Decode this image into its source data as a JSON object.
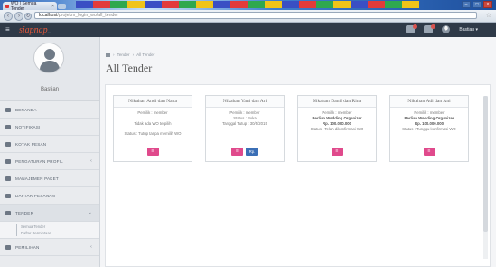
{
  "browser": {
    "tab_title": "WO | Semua Tender",
    "tab_close": "×",
    "url_host": "localhost",
    "url_path": "/projekm_login_wo/all_tender",
    "window_buttons": [
      "–",
      "□",
      "×"
    ],
    "strip_colors": [
      "#3a4fc4",
      "#e23b3b",
      "#2fa84f",
      "#f0c419",
      "#3a4fc4",
      "#e23b3b",
      "#2fa84f",
      "#f0c419",
      "#3a4fc4",
      "#e23b3b",
      "#2fa84f",
      "#f0c419",
      "#3a4fc4",
      "#e23b3b",
      "#2fa84f",
      "#f0c419",
      "#3a4fc4",
      "#e23b3b",
      "#2fa84f",
      "#f0c419"
    ]
  },
  "app": {
    "logo": "siapnap",
    "logo_suffix": "...",
    "menu_icon": "≡",
    "user_name": "Bastian ▾"
  },
  "sidebar": {
    "profile_name": "Bastian",
    "items": [
      {
        "label": "BERANDA",
        "icon": "home-icon"
      },
      {
        "label": "NOTIFIKASI",
        "icon": "bell-icon"
      },
      {
        "label": "KOTAK PESAN",
        "icon": "envelope-icon"
      },
      {
        "label": "PENGATURAN PROFIL",
        "icon": "gear-icon",
        "caret": "‹"
      },
      {
        "label": "MANAJEMEN PAKET",
        "icon": "briefcase-icon"
      },
      {
        "label": "DAFTAR PESANAN",
        "icon": "cart-icon"
      },
      {
        "label": "TENDER",
        "icon": "gavel-icon",
        "caret": "⌄"
      },
      {
        "label": "PEMILIHAN",
        "icon": "star-icon",
        "caret": "‹"
      }
    ],
    "submenu": [
      "Semua Tender",
      "Daftar Permintaan"
    ]
  },
  "main": {
    "breadcrumb": [
      "Tender",
      "All Tender"
    ],
    "breadcrumb_sep": "›",
    "title": "All Tender",
    "cards": [
      {
        "title": "Nikahan Andi dan Nana",
        "lines": [
          {
            "text": "Pemilik : member",
            "bold": false
          },
          {
            "text": "Tidak ada WO terpilih",
            "bold": false
          },
          {
            "text": "Status : Tutup tanpa memilih WO",
            "bold": false
          }
        ],
        "buttons": [
          "pink"
        ]
      },
      {
        "title": "Nikahan Yani dan Ari",
        "lines": [
          {
            "text": "Pemilik : member",
            "bold": false
          },
          {
            "text": "Status : Buka",
            "bold": false
          },
          {
            "text": "Tanggal Tutup : 30/5/2015",
            "bold": false
          }
        ],
        "buttons": [
          "pink",
          "blue"
        ],
        "blue_label": "Rp."
      },
      {
        "title": "Nikahan Danil dan Rina",
        "lines": [
          {
            "text": "Pemilik : member",
            "bold": false
          },
          {
            "text": "Berlian Wedding Organizer",
            "bold": true
          },
          {
            "text": "Rp. 100.000.000",
            "bold": true
          },
          {
            "text": "Status : Telah dikonfirmasi WO",
            "bold": false
          }
        ],
        "buttons": [
          "pink"
        ]
      },
      {
        "title": "Nikahan Adi dan Ani",
        "lines": [
          {
            "text": "Pemilik : member",
            "bold": false
          },
          {
            "text": "Berlian Wedding Organizer",
            "bold": true
          },
          {
            "text": "Rp. 100.000.000",
            "bold": true
          },
          {
            "text": "Status : Tunggu konfirmasi WO",
            "bold": false
          }
        ],
        "buttons": [
          "pink"
        ]
      }
    ],
    "pink_button_glyph": "≡"
  },
  "colors": {
    "topbar": "#2f3a48",
    "logo": "#e3573a",
    "pink_button": "#e04a8c",
    "blue_button": "#3b6fb6"
  }
}
